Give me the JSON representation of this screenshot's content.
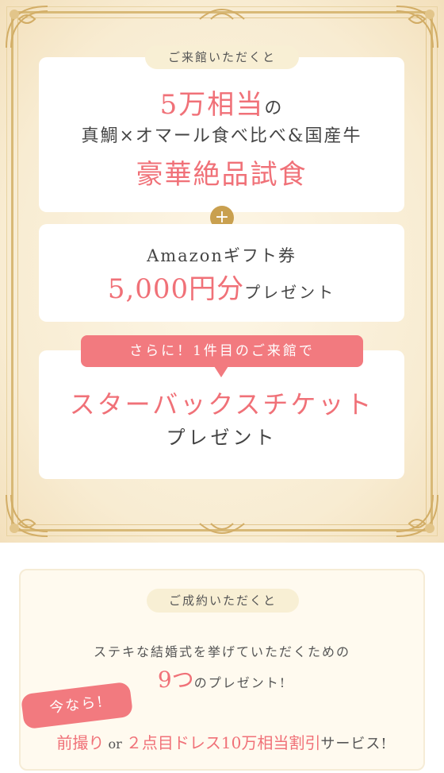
{
  "visit": {
    "pill": "ご来館いただくと",
    "line1_highlight": "5万相当",
    "line1_suffix": "の",
    "line2": "真鯛×オマール食べ比べ&国産牛",
    "line3": "豪華絶品試食",
    "plus_icon": "+",
    "gift_title": "Amazonギフト券",
    "gift_amount": "5,000円分",
    "gift_suffix": "プレゼント",
    "banner": "さらに！1件目のご来館で",
    "starbucks": "スターバックスチケット",
    "starbucks_suffix": "プレゼント"
  },
  "contract": {
    "pill": "ご成約いただくと",
    "line1": "ステキな結婚式を挙げていただくための",
    "count": "9つ",
    "count_suffix": "のプレゼント!",
    "tag": "今なら!",
    "offer_a": "前撮り",
    "offer_or": "or",
    "offer_b": "２点目ドレス10万相当割引",
    "offer_suffix": "サービス!"
  },
  "colors": {
    "accent": "#f07178",
    "gold": "#c9a04f",
    "cream": "#f8efd4"
  }
}
